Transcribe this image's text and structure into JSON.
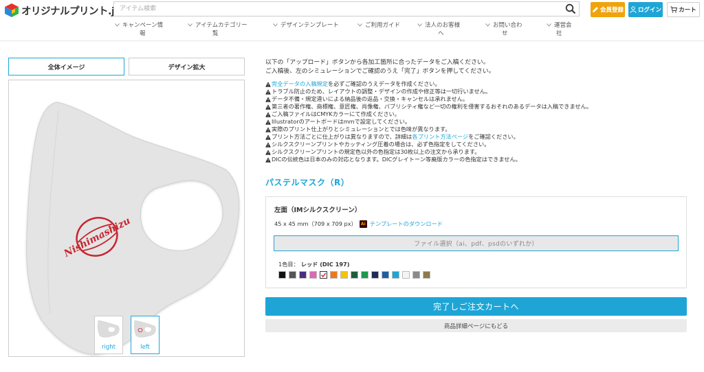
{
  "header": {
    "logo_text": "オリジナルプリント.jp",
    "search_placeholder": "アイテム検索",
    "register_label": "会員登録",
    "login_label": "ログイン",
    "cart_label": "カート"
  },
  "nav": {
    "items": [
      {
        "line1": "キャンペーン情",
        "line2": "報"
      },
      {
        "line1": "アイテムカテゴリー",
        "line2": "覧"
      },
      {
        "line1": "デザインテンプレート",
        "line2": ""
      },
      {
        "line1": "ご利用ガイド",
        "line2": ""
      },
      {
        "line1": "法人のお客様",
        "line2": "へ"
      },
      {
        "line1": "お問い合わ",
        "line2": "せ"
      },
      {
        "line1": "運営会",
        "line2": "社"
      }
    ]
  },
  "left": {
    "tab_overall": "全体イメージ",
    "tab_zoom": "デザイン拡大",
    "print_text": "Nishimashizu",
    "thumbs": [
      {
        "label": "right"
      },
      {
        "label": "left"
      }
    ]
  },
  "right": {
    "intro_1": "以下の「アップロード」ボタンから各加工箇所に合ったデータをご入稿ください。",
    "intro_2": "ご入稿後、左のシミュレーションでご確認のうえ「完了」ボタンを押してください。",
    "notes": [
      {
        "pre": "",
        "link": "完全データの入稿規定",
        "post": "を必ずご確認のうえデータを作成ください。"
      },
      {
        "pre": "トラブル防止のため、レイアウトの調整・デザインの作成や修正等は一切行いません。",
        "link": "",
        "post": ""
      },
      {
        "pre": "データ不備・規定違いによる納品後の返品・交換・キャンセルは承れません。",
        "link": "",
        "post": ""
      },
      {
        "pre": "第三者の著作権、商標権、意匠権、肖像権、パブリシティ権など一切の権利を侵害するおそれのあるデータは入稿できません。",
        "link": "",
        "post": ""
      },
      {
        "pre": "ご入稿ファイルはCMYKカラーにて作成ください。",
        "link": "",
        "post": ""
      },
      {
        "pre": "Illustratorのアートボードはmmで設定してください。",
        "link": "",
        "post": ""
      },
      {
        "pre": "実際のプリント仕上がりとシミュレーションとでは色味が異なります。",
        "link": "",
        "post": ""
      },
      {
        "pre": "プリント方法ごとに仕上がりは異なりますので、詳細は",
        "link": "各プリント方法ページ",
        "post": "をご確認ください。"
      },
      {
        "pre": "シルクスクリーンプリントやカッティング圧着の場合は、必ず色指定をしてください。",
        "link": "",
        "post": ""
      },
      {
        "pre": "シルクスクリーンプリントの規定色以外の色指定は30枚以上の注文から承ります。",
        "link": "",
        "post": ""
      },
      {
        "pre": "DICの伝統色は日本のみの対応となります。DICグレイトーン等廃版カラーの色指定はできません。",
        "link": "",
        "post": ""
      }
    ],
    "product_title": "パステルマスク（R）",
    "side_title": "左面（IMシルクスクリーン）",
    "dimensions": "45 x 45 mm（709 x 709 px）",
    "ai_icon_text": "Ai",
    "template_link": "テンプレートのダウンロード",
    "file_select": "ファイル選択（ai、pdf、psdのいずれか）",
    "color_prefix": "1色目：",
    "color_value": "レッド (DIC 197)",
    "swatches": [
      "#111111",
      "#555555",
      "#4b2e83",
      "#d96bb5",
      "#d7263d",
      "#f07818",
      "#f5c400",
      "#1f5d3a",
      "#1a9a4a",
      "#1f2a5a",
      "#1d5fa0",
      "#1ea5d6",
      "#f4f4f4",
      "#8a8a8a",
      "#8c7a4b"
    ],
    "selected_swatch_index": 4,
    "order_button": "完了しご注文カートへ",
    "back_button": "商品詳細ページにもどる"
  },
  "colors": {
    "accent": "#1ea5d6",
    "register": "#f0a30a",
    "print_red": "#c8242f",
    "mask_gray": "#e5e5e5"
  }
}
